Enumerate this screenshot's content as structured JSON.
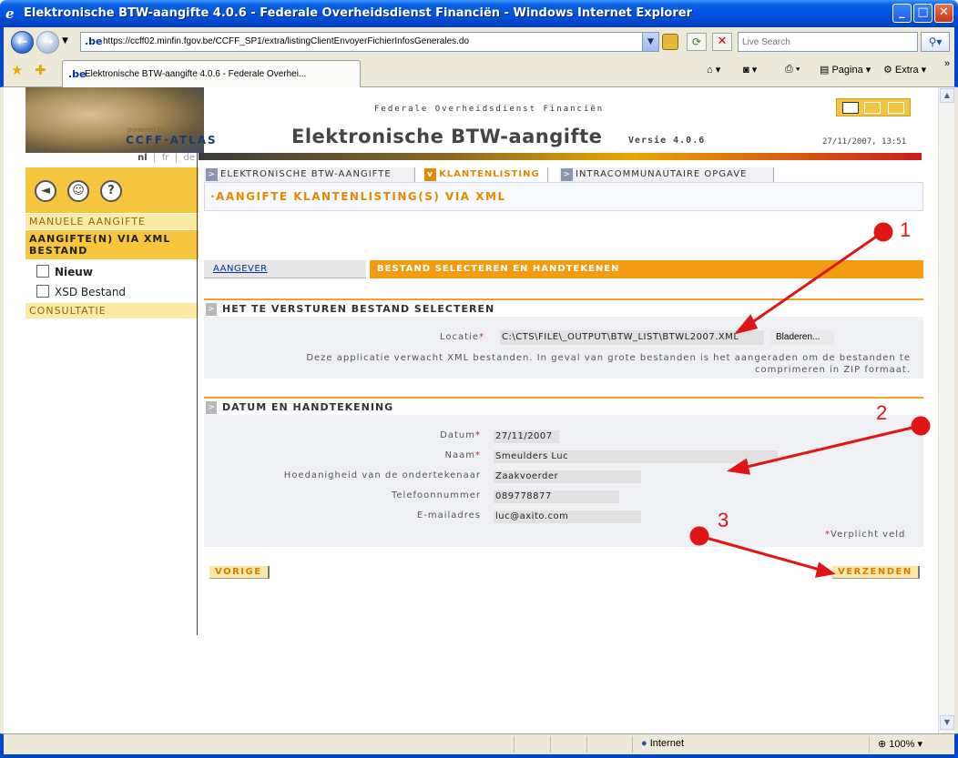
{
  "window": {
    "title": "Elektronische BTW-aangifte 4.0.6 - Federale Overheidsdienst Financiën - Windows Internet Explorer",
    "minimize": "_",
    "maximize": "□",
    "close": "✕"
  },
  "address_bar": {
    "favicon_text": ".be",
    "url": "https://ccff02.minfin.fgov.be/CCFF_SP1/extra/listingClientEnvoyerFichierInfosGenerales.do",
    "search_placeholder": "Live Search"
  },
  "tab_bar": {
    "tab_title": "Elektronische BTW-aangifte 4.0.6 - Federale Overhei...",
    "page_menu": "Pagina",
    "extra_menu": "Extra"
  },
  "header": {
    "powered_by": "powered by",
    "brand": "CCFF·ATLAS",
    "agency": "Federale Overheidsdienst Financiën",
    "app_title": "Elektronische BTW-aangifte",
    "version": "Versie 4.0.6",
    "datetime": "27/11/2007, 13:51"
  },
  "languages": {
    "nl": "nl",
    "fr": "fr",
    "de": "de"
  },
  "nav": {
    "manual": "MANUELE AANGIFTE",
    "xml": "AANGIFTE(N) VIA XML BESTAND",
    "nieuw": "Nieuw",
    "xsd": "XSD Bestand",
    "consultatie": "CONSULTATIE"
  },
  "tabs": [
    {
      "label": "ELEKTRONISCHE BTW-AANGIFTE"
    },
    {
      "label": "KLANTENLISTING"
    },
    {
      "label": "INTRACOMMUNAUTAIRE OPGAVE"
    }
  ],
  "page_title": "·AANGIFTE KLANTENLISTING(S) VIA XML",
  "steps": {
    "step1": "AANGEVER",
    "step2": "BESTAND SELECTEREN EN HANDTEKENEN"
  },
  "section_file": {
    "title": "HET TE VERSTUREN BESTAND SELECTEREN",
    "locatie_label": "Locatie",
    "locatie_value": "C:\\CTS\\FILE\\_OUTPUT\\BTW_LIST\\BTWL2007.XML",
    "browse_button": "Bladeren...",
    "note_line1": "Deze applicatie verwacht XML bestanden. In geval van grote bestanden is het aangeraden om de bestanden te",
    "note_line2": "comprimeren in ZIP formaat."
  },
  "section_sign": {
    "title": "DATUM EN HANDTEKENING",
    "datum_label": "Datum",
    "datum_value": "27/11/2007",
    "naam_label": "Naam",
    "naam_value": "Smeulders Luc",
    "hoedanigheid_label": "Hoedanigheid van de ondertekenaar",
    "hoedanigheid_value": "Zaakvoerder",
    "telefoon_label": "Telefoonnummer",
    "telefoon_value": "089778877",
    "email_label": "E-mailadres",
    "email_value": "luc@axito.com",
    "required_note": "Verplicht veld",
    "required_mark": "*"
  },
  "actions": {
    "previous": "VORIGE",
    "submit": "VERZENDEN"
  },
  "annotations": {
    "n1": "1",
    "n2": "2",
    "n3": "3",
    "color": "#e01515"
  },
  "status_bar": {
    "zone": "Internet",
    "zoom": "100%"
  }
}
